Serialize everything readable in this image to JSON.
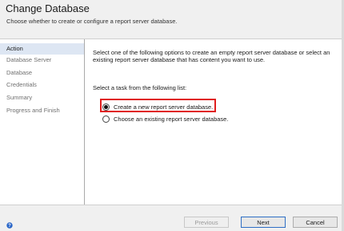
{
  "header": {
    "title": "Change Database",
    "subtitle": "Choose whether to create or configure a report server database."
  },
  "sidebar": {
    "items": [
      {
        "label": "Action",
        "active": true
      },
      {
        "label": "Database Server",
        "active": false
      },
      {
        "label": "Database",
        "active": false
      },
      {
        "label": "Credentials",
        "active": false
      },
      {
        "label": "Summary",
        "active": false
      },
      {
        "label": "Progress and Finish",
        "active": false
      }
    ]
  },
  "content": {
    "description": "Select one of the following options to create an empty report server database or select an existing report server database that has content you want to use.",
    "task_label": "Select a task from the following list:",
    "options": [
      {
        "label": "Create a new report server database.",
        "selected": true
      },
      {
        "label": "Choose an existing report server database.",
        "selected": false
      }
    ]
  },
  "footer": {
    "help_icon": "help-icon",
    "previous_label": "Previous",
    "next_label": "Next",
    "cancel_label": "Cancel"
  },
  "colors": {
    "highlight": "#e01e1e",
    "active_nav": "#dde6f3"
  }
}
